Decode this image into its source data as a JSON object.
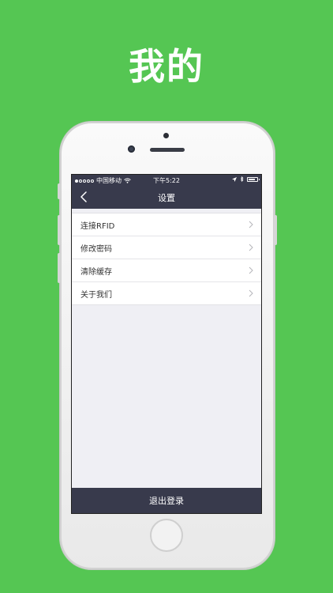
{
  "promo": {
    "title": "我的"
  },
  "status_bar": {
    "carrier": "中国移动",
    "time": "下午5:22"
  },
  "nav": {
    "title": "设置",
    "back_icon": "chevron-left-icon"
  },
  "settings": {
    "items": [
      {
        "label": "连接RFID",
        "icon": "chevron-right-icon"
      },
      {
        "label": "修改密码",
        "icon": "chevron-right-icon"
      },
      {
        "label": "清除缓存",
        "icon": "chevron-right-icon"
      },
      {
        "label": "关于我们",
        "icon": "chevron-right-icon"
      }
    ]
  },
  "logout": {
    "label": "退出登录"
  },
  "colors": {
    "background": "#55c653",
    "bar": "#383a4c",
    "screen_bg": "#efeff4"
  }
}
